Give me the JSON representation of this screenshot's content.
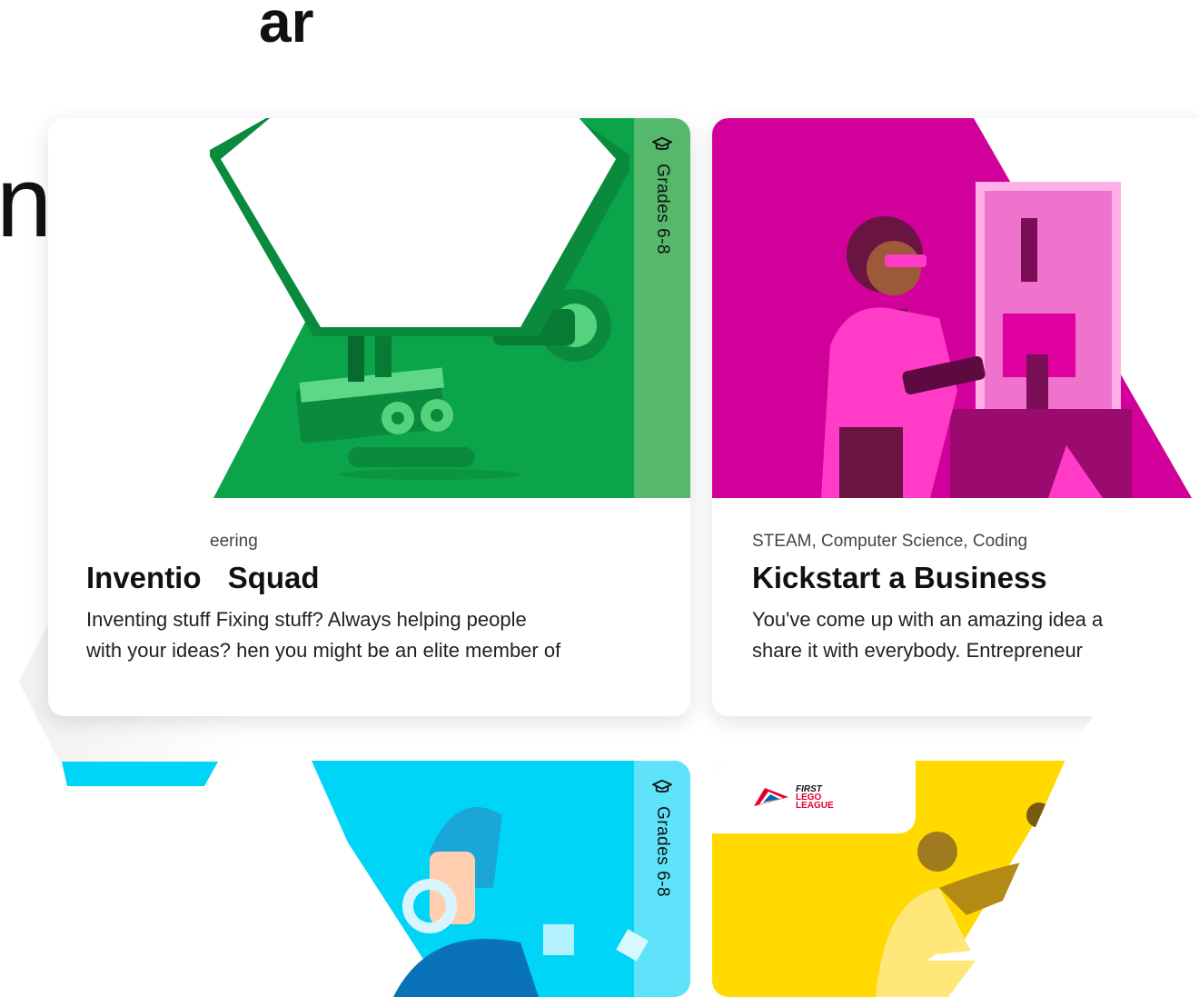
{
  "page": {
    "heading_fragment_top": "ar",
    "heading_fragment_left": "n"
  },
  "cards": [
    {
      "category": "eering",
      "title_a": "Inventio",
      "title_b": "Squad",
      "desc_line1_a": "Inventing stuff",
      "desc_line1_b": "Fixing stuff? Always helping people",
      "desc_line2_a": "with your ideas?",
      "desc_line2_b": "hen you might be an elite member of",
      "grade": "Grades 6-8",
      "color": "#0ca44a"
    },
    {
      "category": "STEAM, Computer Science, Coding",
      "title": "Kickstart a Business",
      "desc_line1": "You've come up with an amazing idea a",
      "desc_line2": "share it with everybody. Entrepreneur",
      "color": "#d1009a"
    },
    {
      "grade": "Grades 6-8",
      "color": "#00d4f7"
    },
    {
      "logo_line1": "FIRST",
      "logo_line2": "LEGO",
      "logo_line3": "LEAGUE",
      "color": "#ffd900"
    }
  ]
}
